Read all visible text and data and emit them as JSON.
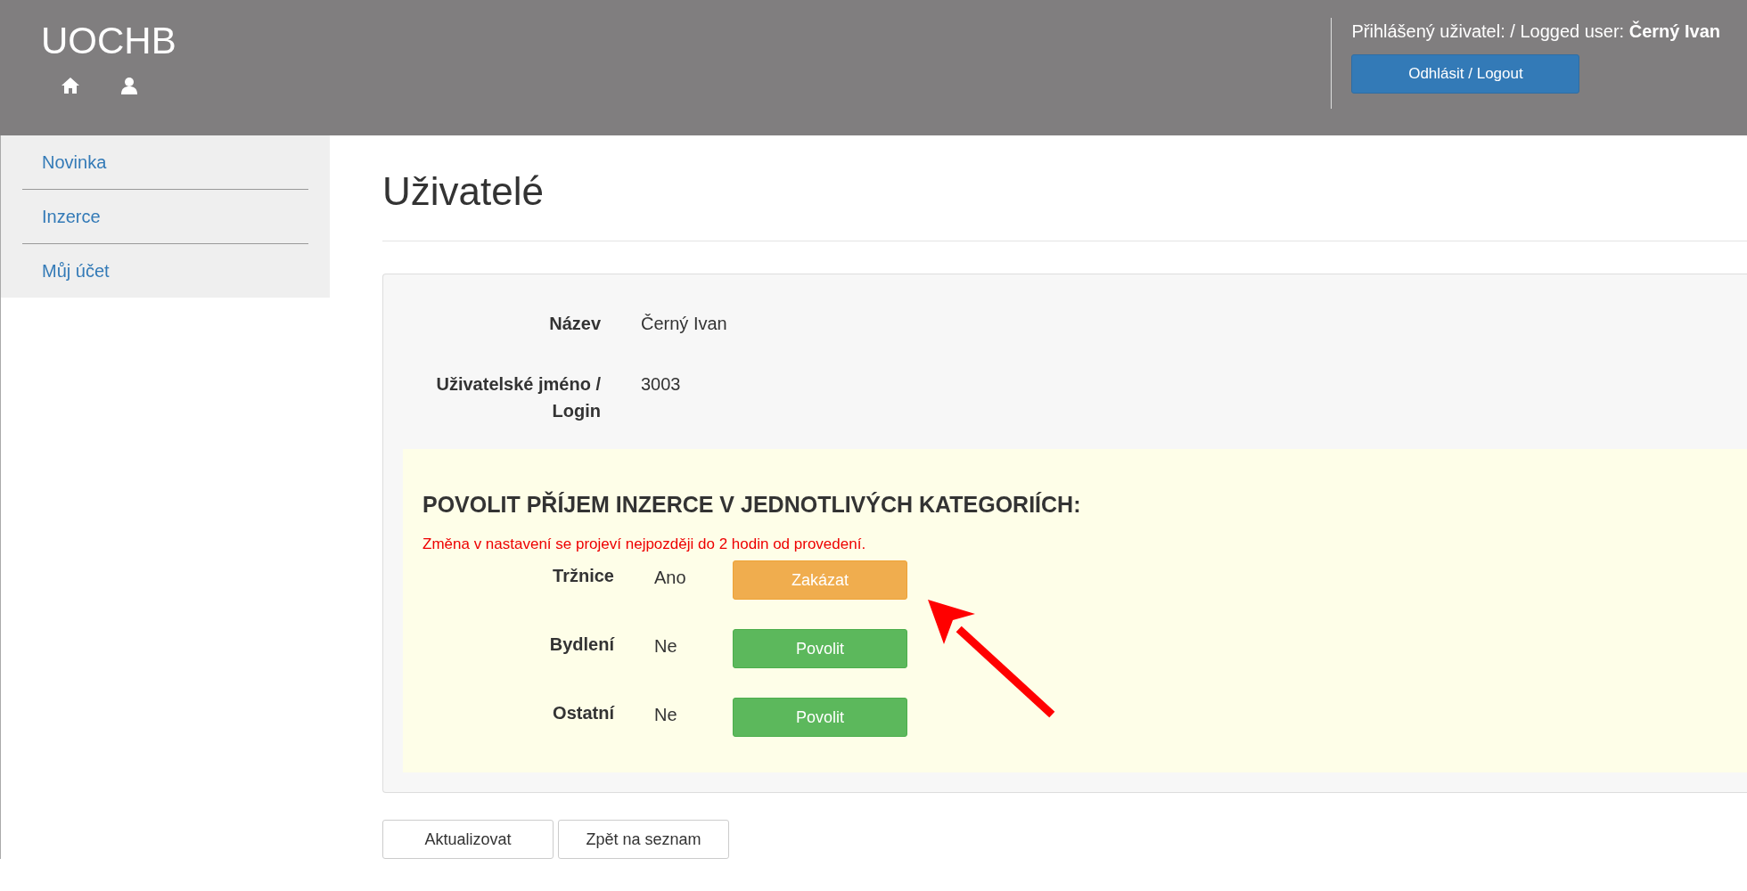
{
  "header": {
    "logo": "UOCHB",
    "user_label": "Přihlášený uživatel: / Logged user:",
    "user_name": "Černý Ivan",
    "logout_button": "Odhlásit / Logout"
  },
  "sidebar": {
    "items": [
      {
        "label": "Novinka",
        "selected": false
      },
      {
        "label": "Inzerce",
        "selected": false
      },
      {
        "label": "Můj účet",
        "selected": false
      }
    ]
  },
  "page_title": "Uživatelé",
  "fields": [
    {
      "label": "Název",
      "value": "Černý Ivan"
    },
    {
      "label": "Uživatelské jméno / Login",
      "value": "3003"
    }
  ],
  "categories_section": {
    "heading": "POVOLIT PŘÍJEM INZERCE V JEDNOTLIVÝCH KATEGORIÍCH:",
    "notice": "Změna v nastavení se projeví nejpozději do 2 hodin od provedení.",
    "rows": [
      {
        "label": "Tržnice",
        "value": "Ano",
        "enabled": true,
        "button": "Zakázat"
      },
      {
        "label": "Bydlení",
        "value": "Ne",
        "enabled": false,
        "button": "Povolit"
      },
      {
        "label": "Ostatní",
        "value": "Ne",
        "enabled": false,
        "button": "Povolit"
      }
    ]
  },
  "buttons": [
    "Aktualizovat",
    "Zpět na seznam"
  ]
}
